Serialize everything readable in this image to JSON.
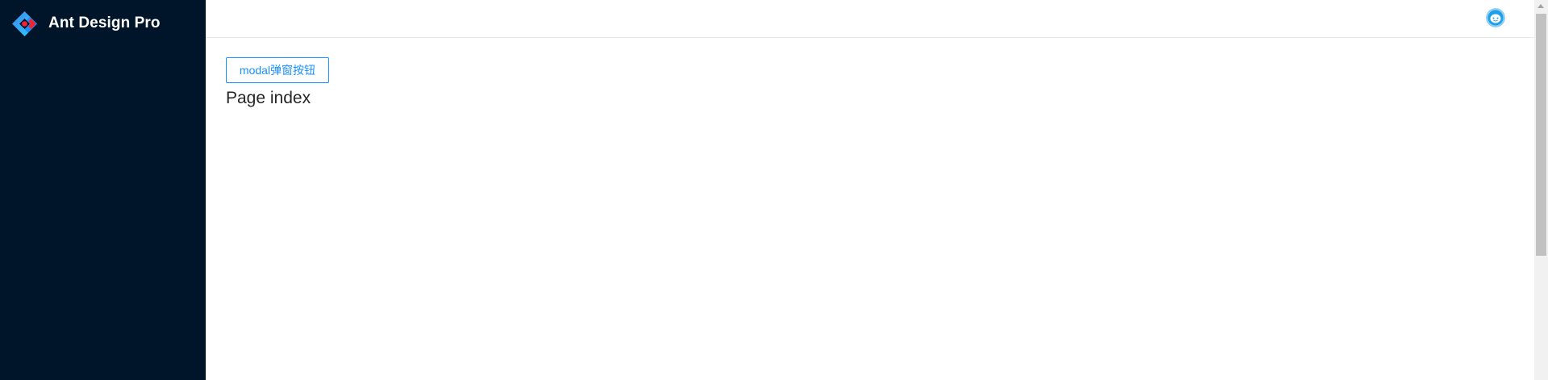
{
  "sidebar": {
    "logo_icon": "ant-design-logo-icon",
    "title": "Ant Design Pro",
    "background": "#001529"
  },
  "header": {
    "avatar_icon": "user-avatar-icon"
  },
  "content": {
    "modal_button_label": "modal弹窗按钮",
    "page_title": "Page index"
  },
  "colors": {
    "primary": "#1890ff",
    "logo_red": "#f5222d"
  }
}
